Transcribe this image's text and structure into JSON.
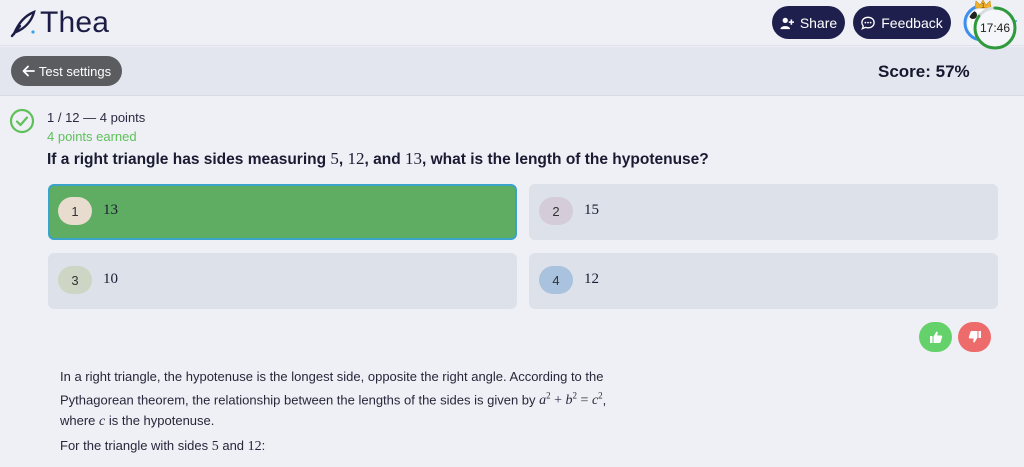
{
  "header": {
    "logo_text": "Thea",
    "share_label": "Share",
    "feedback_label": "Feedback",
    "avatar_badge": "1"
  },
  "subbar": {
    "back_label": "Test settings",
    "score_text": "Score: 57%",
    "timer_text": "17:46",
    "timer_fraction": 0.85
  },
  "question": {
    "meta": "1 / 12 — 4 points",
    "earned": "4 points earned",
    "text_before": "If a right triangle has sides measuring ",
    "n1": "5",
    "sep1": ", ",
    "n2": "12",
    "sep2": ", and ",
    "n3": "13",
    "text_after": ", what is the length of the hypotenuse?"
  },
  "options": [
    {
      "num": "1",
      "value": "13",
      "state": "correct"
    },
    {
      "num": "2",
      "value": "15",
      "state": "default"
    },
    {
      "num": "3",
      "value": "10",
      "state": "default"
    },
    {
      "num": "4",
      "value": "12",
      "state": "default"
    }
  ],
  "explanation": {
    "p1_a": "In a right triangle, the hypotenuse is the longest side, opposite the right angle. According to the Pythagorean theorem, the relationship between the lengths of the sides is given by ",
    "formula_a": "a",
    "formula_plus": " + ",
    "formula_b": "b",
    "formula_eq": " = ",
    "formula_c": "c",
    "exp2": "2",
    "p1_b": ",",
    "p1_c": "where ",
    "var_c": "c",
    "p1_d": " is the hypotenuse.",
    "p2_a": "For the triangle with sides ",
    "p2_n1": "5",
    "p2_and": " and ",
    "p2_n2": "12",
    "p2_b": ":"
  },
  "colors": {
    "correct_bg": "#5fad62",
    "correct_border": "#3aa3c9",
    "header_button": "#1f1f4d",
    "check_green": "#5fc05a",
    "thumb_up": "#65d16a",
    "thumb_down": "#ee6b6b",
    "timer_ring": "#2e9a3c"
  },
  "icons": {
    "logo": "feather-pen-icon",
    "share": "add-user-icon",
    "feedback": "chat-bubble-icon",
    "back": "arrow-left-icon",
    "check": "check-circle-icon",
    "thumb_up": "thumbs-up-icon",
    "thumb_down": "thumbs-down-icon",
    "avatar_menu": "chevron-down-icon"
  }
}
